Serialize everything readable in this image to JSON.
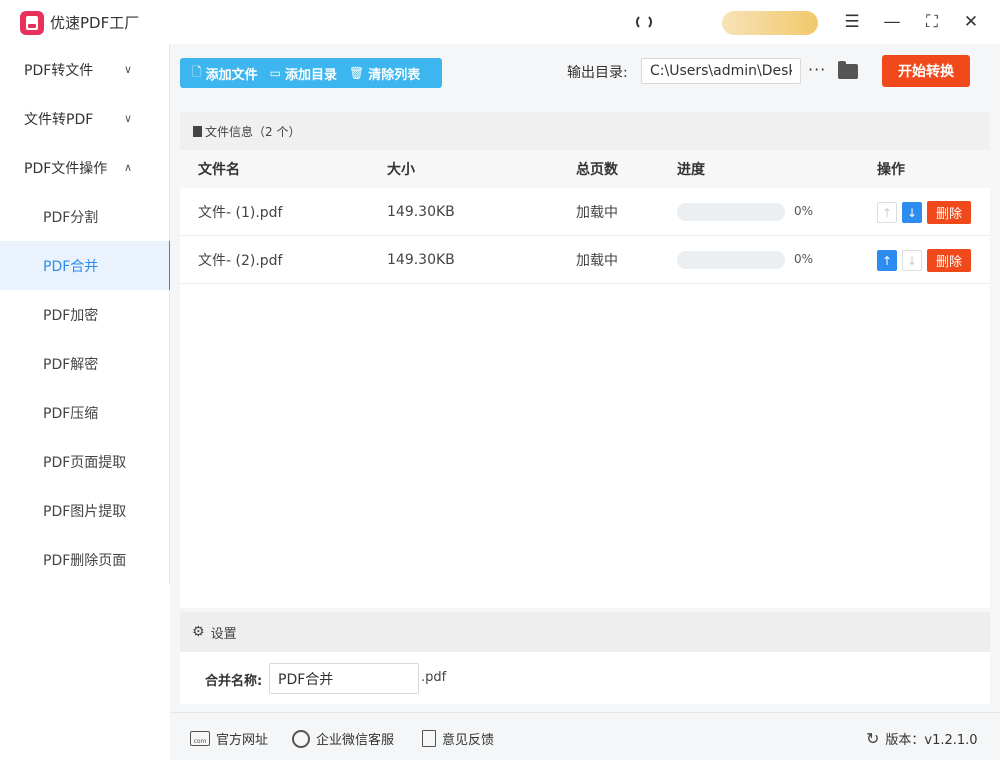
{
  "app": {
    "title": "优速PDF工厂"
  },
  "window": {
    "menu_icon": "☰",
    "min_icon": "—",
    "max_icon": "⛶",
    "close_icon": "✕"
  },
  "sidebar": {
    "groups": [
      {
        "label": "PDF转文件",
        "chevron": "∨"
      },
      {
        "label": "文件转PDF",
        "chevron": "∨"
      },
      {
        "label": "PDF文件操作",
        "chevron": "∧"
      }
    ],
    "sub_items": [
      {
        "label": "PDF分割"
      },
      {
        "label": "PDF合并"
      },
      {
        "label": "PDF加密"
      },
      {
        "label": "PDF解密"
      },
      {
        "label": "PDF压缩"
      },
      {
        "label": "PDF页面提取"
      },
      {
        "label": "PDF图片提取"
      },
      {
        "label": "PDF删除页面"
      }
    ],
    "active_sub": "PDF合并"
  },
  "toolbar": {
    "add_file": "添加文件",
    "add_dir": "添加目录",
    "clear_list": "清除列表",
    "output_label": "输出目录:",
    "output_path": "C:\\Users\\admin\\Desktop",
    "more": "···",
    "start": "开始转换"
  },
  "file_panel": {
    "header": "文件信息（2 个）",
    "columns": {
      "name": "文件名",
      "size": "大小",
      "pages": "总页数",
      "progress": "进度",
      "actions": "操作"
    },
    "rows": [
      {
        "name": "文件- (1).pdf",
        "size": "149.30KB",
        "pages": "加载中",
        "progress_pct": "0%",
        "progress_value": 0,
        "delete": "删除",
        "up_enabled": false,
        "down_enabled": true
      },
      {
        "name": "文件- (2).pdf",
        "size": "149.30KB",
        "pages": "加载中",
        "progress_pct": "0%",
        "progress_value": 0,
        "delete": "删除",
        "up_enabled": true,
        "down_enabled": false
      }
    ]
  },
  "settings": {
    "header": "设置",
    "merge_label": "合并名称:",
    "merge_value": "PDF合并",
    "merge_ext": ".pdf"
  },
  "footer": {
    "website": "官方网址",
    "wechat": "企业微信客服",
    "feedback": "意见反馈",
    "version": "版本：v1.2.1.0"
  },
  "colors": {
    "accent": "#2d8cf0",
    "toolbar": "#3db6ef",
    "danger": "#f04a1c",
    "logo": "#e8305a"
  }
}
